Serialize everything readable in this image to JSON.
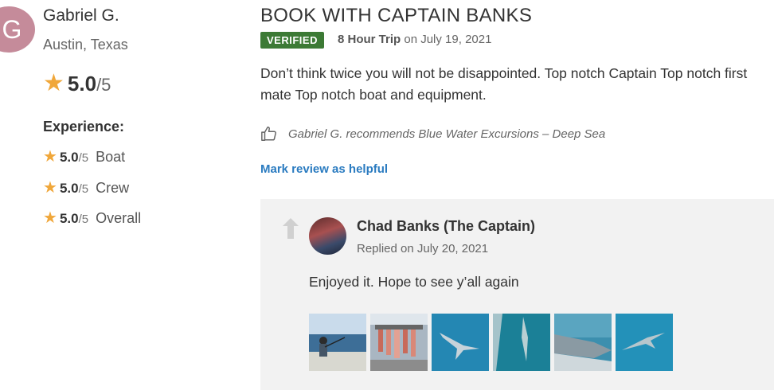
{
  "reviewer": {
    "initial": "G",
    "name": "Gabriel G.",
    "location": "Austin, Texas",
    "overall_score": "5.0",
    "overall_max": "/5"
  },
  "experience": {
    "title": "Experience:",
    "items": [
      {
        "score": "5.0",
        "max": "/5",
        "label": "Boat"
      },
      {
        "score": "5.0",
        "max": "/5",
        "label": "Crew"
      },
      {
        "score": "5.0",
        "max": "/5",
        "label": "Overall"
      }
    ]
  },
  "review": {
    "title": "BOOK WITH CAPTAIN BANKS",
    "badge": "VERIFIED",
    "trip": "8 Hour Trip",
    "date": "on July 19, 2021",
    "text": "Don’t think twice you will not be disappointed. Top notch Captain Top notch first mate Top notch boat and equipment.",
    "recommend": "Gabriel G. recommends Blue Water Excursions – Deep Sea",
    "helpful_link": "Mark review as helpful"
  },
  "reply": {
    "name": "Chad Banks (The Captain)",
    "date": "Replied on July 20, 2021",
    "text": "Enjoyed it. Hope to see y’all again",
    "photos": [
      "photo-1",
      "photo-2",
      "photo-3",
      "photo-4",
      "photo-5",
      "photo-6"
    ]
  },
  "colors": {
    "star": "#f0a73a",
    "verified": "#3c7a35",
    "link": "#2a7bc0",
    "avatar": "#c58b9a"
  }
}
